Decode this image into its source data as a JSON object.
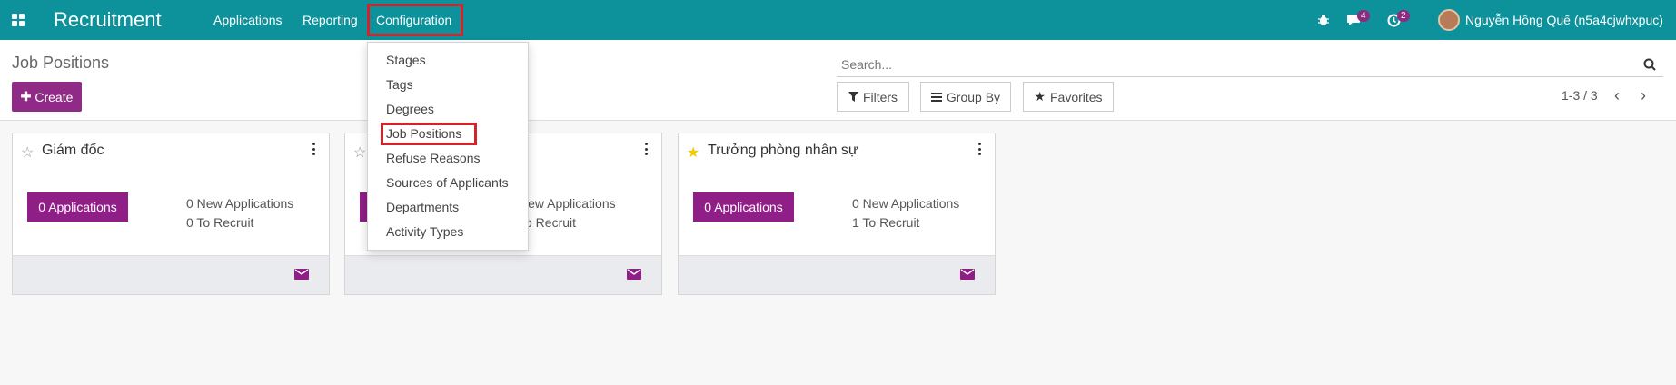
{
  "navbar": {
    "brand": "Recruitment",
    "menus": [
      "Applications",
      "Reporting",
      "Configuration"
    ],
    "messages_count": "4",
    "activities_count": "2",
    "user_name": "Nguyễn Hồng Quế (n5a4cjwhxpuc)"
  },
  "control_panel": {
    "title": "Job Positions",
    "create_label": "Create",
    "search_placeholder": "Search...",
    "filters_label": "Filters",
    "group_by_label": "Group By",
    "favorites_label": "Favorites",
    "pager": "1-3 / 3"
  },
  "dropdown": {
    "items": [
      "Stages",
      "Tags",
      "Degrees",
      "Job Positions",
      "Refuse Reasons",
      "Sources of Applicants",
      "Departments",
      "Activity Types"
    ],
    "highlighted": "Job Positions"
  },
  "cards": [
    {
      "title": "Giám đốc",
      "favorite": false,
      "applications_label": "0 Applications",
      "new_applications": "0 New Applications",
      "to_recruit": "0 To Recruit"
    },
    {
      "title": "",
      "favorite": false,
      "applications_label": "",
      "new_applications": "New Applications",
      "to_recruit": "To Recruit"
    },
    {
      "title": "Trưởng phòng nhân sự",
      "favorite": true,
      "applications_label": "0 Applications",
      "new_applications": "0 New Applications",
      "to_recruit": "1 To Recruit"
    }
  ],
  "colors": {
    "navbar": "#0d919a",
    "primary": "#8f2a87",
    "highlight_box": "#d2232a",
    "favorite_star": "#f3cc00"
  }
}
